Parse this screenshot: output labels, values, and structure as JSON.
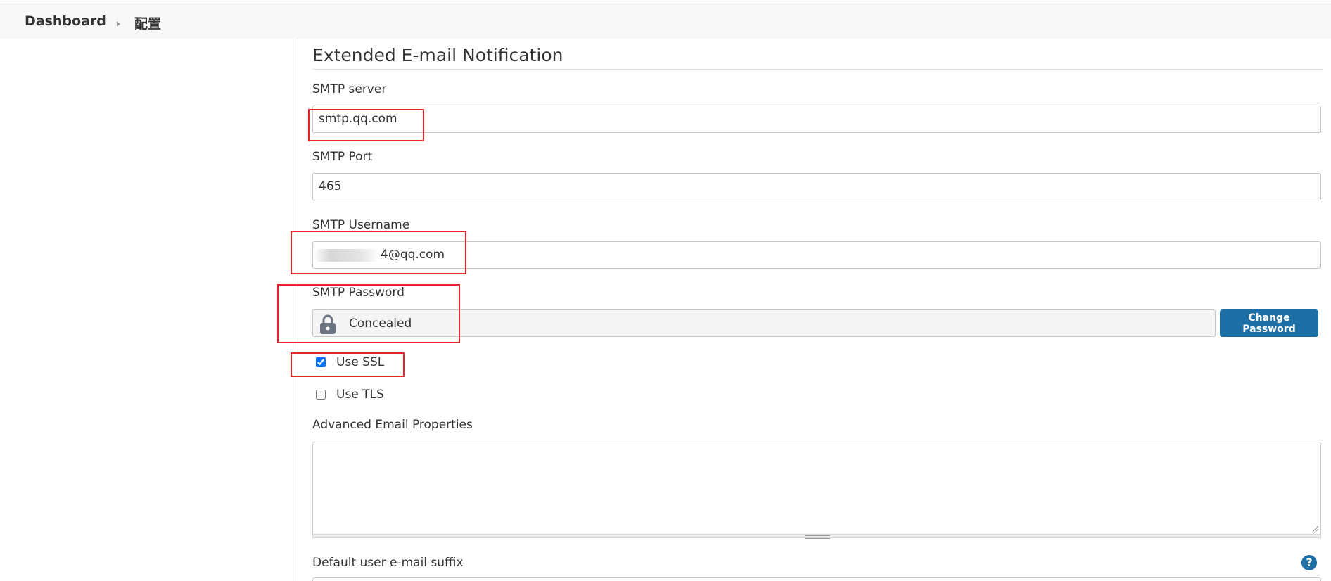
{
  "breadcrumb": {
    "items": [
      "Dashboard",
      "配置"
    ]
  },
  "section": {
    "title": "Extended E-mail Notification"
  },
  "smtp_server": {
    "label": "SMTP server",
    "value": "smtp.qq.com"
  },
  "smtp_port": {
    "label": "SMTP Port",
    "value": "465"
  },
  "smtp_username": {
    "label": "SMTP Username",
    "value": "4@qq.com"
  },
  "smtp_password": {
    "label": "SMTP Password",
    "value": "Concealed",
    "button_label": "Change Password",
    "icon": "lock-icon"
  },
  "use_ssl": {
    "label": "Use SSL",
    "checked": true
  },
  "use_tls": {
    "label": "Use TLS",
    "checked": false
  },
  "advanced_properties": {
    "label": "Advanced Email Properties",
    "value": ""
  },
  "default_suffix": {
    "label": "Default user e-mail suffix",
    "help_icon": "help-icon"
  },
  "colors": {
    "primary_button": "#1d6fa5",
    "annotation_red": "#e8232a"
  }
}
